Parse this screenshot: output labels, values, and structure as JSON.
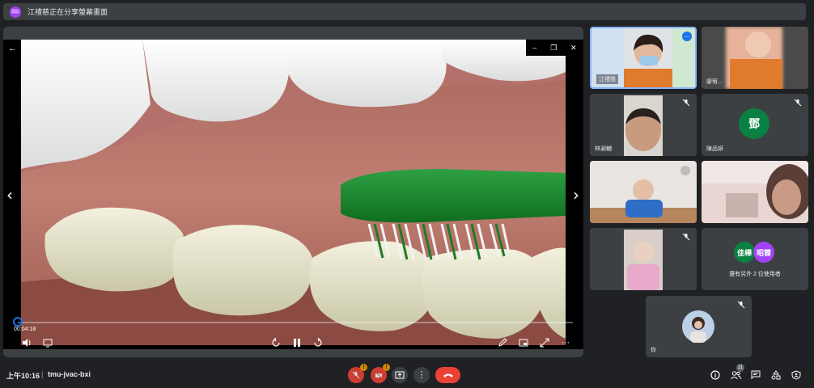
{
  "banner": {
    "badge_text": "頭貼",
    "text": "江禮慈正在分享螢幕畫面"
  },
  "player": {
    "time": "00:04:18",
    "progress_fraction": 0.005
  },
  "participants": [
    {
      "name": "江禮慈",
      "muted": false,
      "active": true
    },
    {
      "name": "廖宥...",
      "muted": false
    },
    {
      "name": "林昶輔",
      "muted": true
    },
    {
      "name": "陳品妍",
      "muted": true,
      "avatar_letter": "鄧",
      "avatar_color": "#0b8043"
    },
    {
      "name": "",
      "muted": false
    },
    {
      "name": "",
      "muted": false
    },
    {
      "name": "",
      "muted": true
    },
    {
      "name": "",
      "muted": false
    },
    {
      "name": "你",
      "muted": true
    }
  ],
  "others": {
    "avatar1": "佳樺",
    "avatar2": "昭蓉",
    "label": "還有另外 2 位使用者",
    "avatar1_color": "#0b8043",
    "avatar2_color": "#a142f4"
  },
  "bottom": {
    "clock": "上午10:16",
    "divider": "|",
    "meeting_code": "tmu-jvac-bxi",
    "mic_badge": "!",
    "cam_badge": "!",
    "people_count": "11"
  },
  "colors": {
    "background": "#202124",
    "tile": "#3c4043",
    "accent": "#1a73e8",
    "end_call": "#ea4335",
    "warning": "#f29900"
  }
}
